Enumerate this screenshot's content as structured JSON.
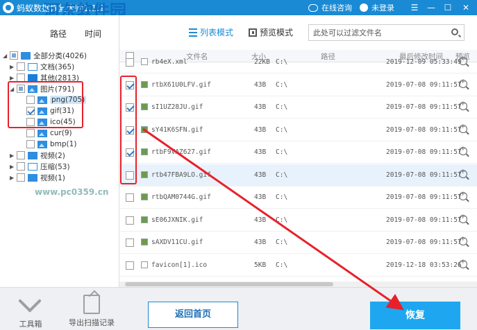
{
  "titlebar": {
    "title": "蚂蚁数据恢复大师1.1.1",
    "watermark": "河东软件园",
    "online_help": "在线咨询",
    "login": "未登录",
    "menu": "☰",
    "minimize": "—",
    "maximize": "☐",
    "close": "✕"
  },
  "left_tabs": {
    "path": "路径",
    "time": "时间"
  },
  "tree": {
    "all": "全部分类(4026)",
    "documents": "文档(365)",
    "other": "其他(2813)",
    "pictures": "图片(791)",
    "png": "png(705)",
    "gif": "gif(31)",
    "ico": "ico(45)",
    "cur": "cur(9)",
    "bmp": "bmp(1)",
    "video1": "视频(2)",
    "archive": "压缩(53)",
    "video2": "视频(1)"
  },
  "watermark_url": "www.pc0359.cn",
  "view": {
    "list_mode": "列表模式",
    "preview_mode": "预览模式",
    "search_placeholder": "此处可以过滤文件名"
  },
  "table": {
    "headers": {
      "name": "文件名",
      "size": "大小",
      "path": "路径",
      "modified": "最后修改时间",
      "preview": "预览"
    },
    "rows": [
      {
        "name": "rb4eX.xml",
        "size": "22KB",
        "path": "C:\\",
        "date": "2019-12-09 05:33:49",
        "checked": false
      },
      {
        "name": "rtbX61U0LFV.gif",
        "size": "43B",
        "path": "C:\\",
        "date": "2019-07-08 09:11:57",
        "checked": true
      },
      {
        "name": "sI1UZ28JU.gif",
        "size": "43B",
        "path": "C:\\",
        "date": "2019-07-08 09:11:57",
        "checked": true
      },
      {
        "name": "sY41K6SFN.gif",
        "size": "43B",
        "path": "C:\\",
        "date": "2019-07-08 09:11:57",
        "checked": true
      },
      {
        "name": "rtbF9VAZ627.gif",
        "size": "43B",
        "path": "C:\\",
        "date": "2019-07-08 09:11:57",
        "checked": true
      },
      {
        "name": "rtb47FBA9LO.gif",
        "size": "43B",
        "path": "C:\\",
        "date": "2019-07-08 09:11:57",
        "checked": false
      },
      {
        "name": "rtbQAM0744G.gif",
        "size": "43B",
        "path": "C:\\",
        "date": "2019-07-08 09:11:57",
        "checked": false
      },
      {
        "name": "sE06JXNIK.gif",
        "size": "43B",
        "path": "C:\\",
        "date": "2019-07-08 09:11:57",
        "checked": false
      },
      {
        "name": "sAXDV11CU.gif",
        "size": "43B",
        "path": "C:\\",
        "date": "2019-07-08 09:11:57",
        "checked": false
      },
      {
        "name": "favicon[1].ico",
        "size": "5KB",
        "path": "C:\\",
        "date": "2019-12-18 03:53:26",
        "checked": false
      }
    ]
  },
  "bottom": {
    "toolbox": "工具箱",
    "export_scan": "导出扫描记录",
    "back_home": "返回首页",
    "recover": "恢复"
  },
  "colors": {
    "accent": "#1a8ad4",
    "recover_button": "#1ea7f0",
    "annotation": "#e8202a"
  }
}
